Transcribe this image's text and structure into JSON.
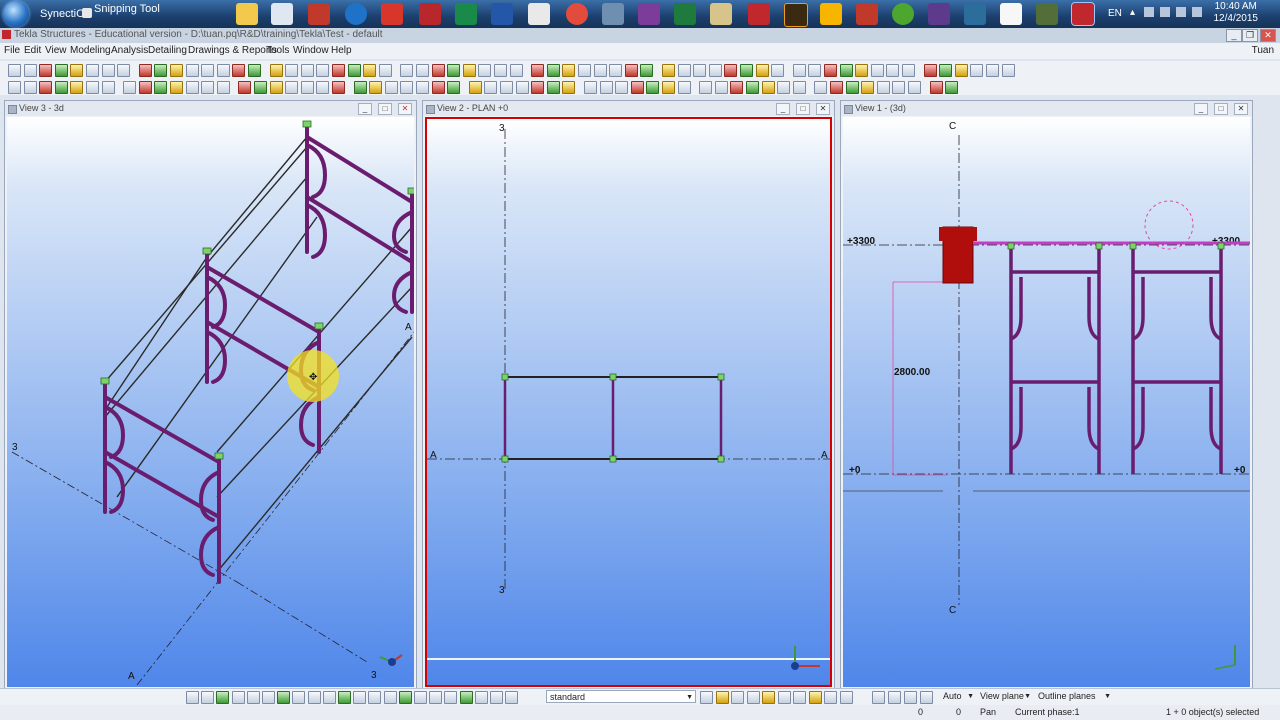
{
  "taskbar": {
    "items": [
      {
        "label": "SynectiCS"
      },
      {
        "label": "Snipping Tool"
      }
    ],
    "language": "EN",
    "clock": {
      "time": "10:40 AM",
      "date": "12/4/2015"
    }
  },
  "app": {
    "title": "Tekla Structures - Educational version - D:\\tuan.pq\\R&D\\training\\Tekla\\Test - default",
    "user": "Tuan"
  },
  "menu": [
    "File",
    "Edit",
    "View",
    "Modeling",
    "Analysis",
    "Detailing",
    "Drawings & Reports",
    "Tools",
    "Window",
    "Help"
  ],
  "views": [
    {
      "title": "View 3 - 3d",
      "labels": {
        "grid_3": "3",
        "grid_a_top": "A",
        "grid_a_bottom": "A",
        "grid_3_bottom": "3"
      }
    },
    {
      "title": "View 2 - PLAN +0",
      "labels": {
        "grid_3_top": "3",
        "grid_3_bottom": "3",
        "grid_a_left": "A",
        "grid_a_right": "A"
      }
    },
    {
      "title": "View 1 - (3d)",
      "labels": {
        "grid_c_top": "C",
        "grid_c_bottom": "C",
        "level_top_left": "+3300",
        "level_top_right": "+3300",
        "level_zero_left": "+0",
        "level_zero_right": "+0",
        "dimension": "2800.00"
      }
    }
  ],
  "bottom_toolbar": {
    "snap_setting": "standard",
    "auto": "Auto",
    "view_plane": "View plane",
    "outline_planes": "Outline planes"
  },
  "status": {
    "x": "0",
    "y": "0",
    "mode": "Pan",
    "phase": "Current phase:1",
    "selection": "1 + 0 object(s) selected"
  },
  "colors": {
    "member": "#6a1d6e",
    "bracing": "#2a2a2a",
    "active_border": "#d60000",
    "column": "#b00d0d",
    "node": "#7bd36a"
  }
}
